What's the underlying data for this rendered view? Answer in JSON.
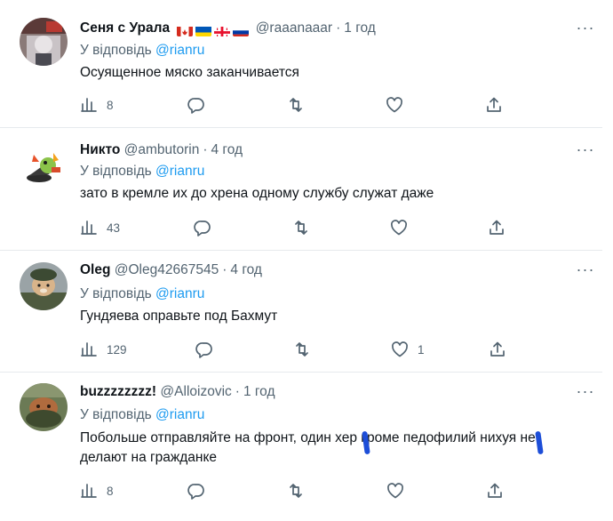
{
  "reply_prefix": "У відповідь",
  "more_label": "···",
  "colors": {
    "link": "#1d9bf0",
    "muted": "#536471",
    "text": "#0f1419",
    "divider": "#e6eaed"
  },
  "tweets": [
    {
      "display_name": "Сеня с Урала",
      "flags": [
        "canada-flag",
        "ukraine-flag",
        "georgia-flag",
        "russia-flag"
      ],
      "handle": "@raaanaaar",
      "time": "1 год",
      "reply_to": "@rianru",
      "text": "Осуященное мяско заканчивается",
      "views": "8",
      "replies": "",
      "retweets": "",
      "likes": ""
    },
    {
      "display_name": "Никто",
      "handle": "@ambutorin",
      "time": "4 год",
      "reply_to": "@rianru",
      "text": "зато в кремле их до хрена одному службу служат даже",
      "views": "43",
      "replies": "",
      "retweets": "",
      "likes": ""
    },
    {
      "display_name": "Oleg",
      "handle": "@Oleg42667545",
      "time": "4 год",
      "reply_to": "@rianru",
      "text": "Гундяева оправьте под Бахмут",
      "views": "129",
      "replies": "",
      "retweets": "",
      "likes": "1"
    },
    {
      "display_name": "buzzzzzzzz!",
      "handle": "@Alloizovic",
      "time": "1 год",
      "reply_to": "@rianru",
      "text": "Побольше отправляйте на фронт, один хер кроме педофилий нихуя не делают на гражданке",
      "views": "8",
      "replies": "",
      "retweets": "",
      "likes": ""
    }
  ]
}
